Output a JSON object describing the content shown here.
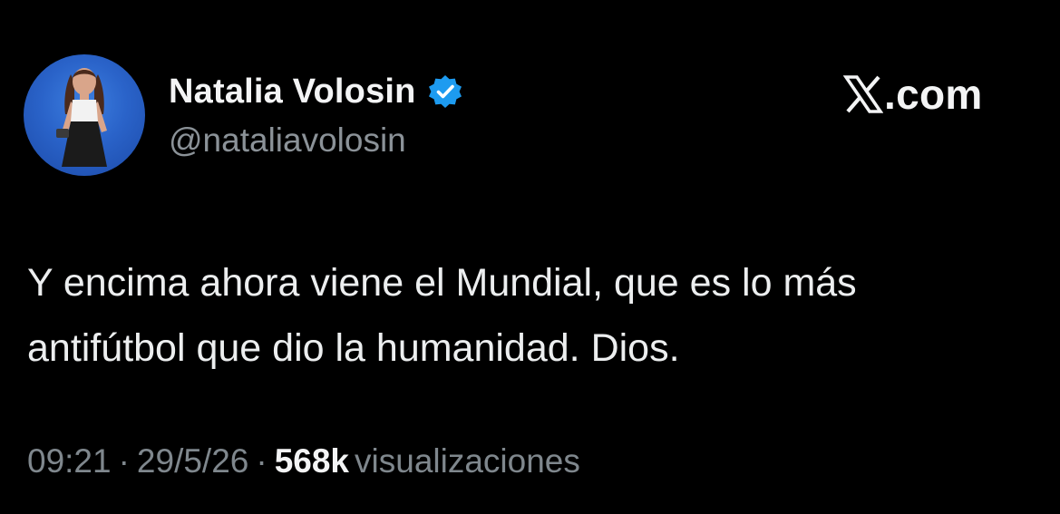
{
  "author": {
    "display_name": "Natalia Volosin",
    "handle": "@nataliavolosin",
    "verified_icon": "verified-badge-icon",
    "avatar_icon": "profile-photo"
  },
  "brand": {
    "domain": ".com",
    "logo_icon": "x-logo-icon"
  },
  "tweet": {
    "lines": [
      "Y encima ahora viene el Mundial, que es lo más",
      "antifútbol que dio la humanidad. Dios."
    ]
  },
  "meta": {
    "time": "09:21",
    "separator": "·",
    "date": "29/5/26",
    "views_count": "568k",
    "views_label": "visualizaciones"
  },
  "colors": {
    "background": "#000000",
    "text_primary": "#e7e9ea",
    "text_secondary": "#7f878d",
    "verified_blue": "#1d9bf0",
    "avatar_blue": "#2a63c9"
  }
}
